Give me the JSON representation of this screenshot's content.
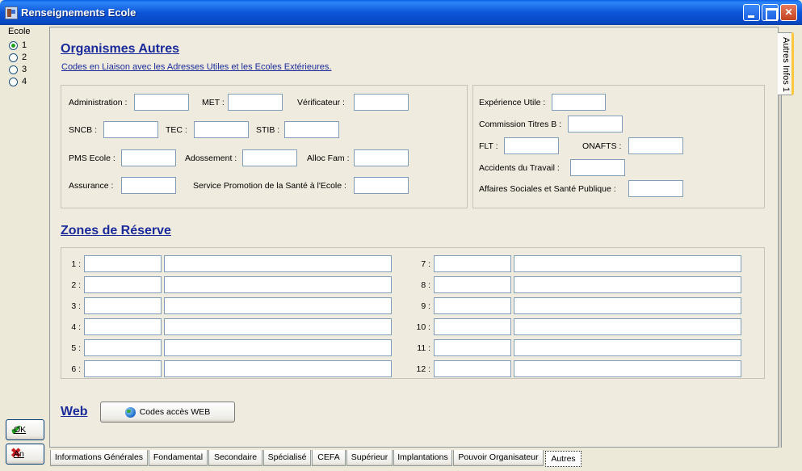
{
  "window": {
    "title": "Renseignements Ecole"
  },
  "left": {
    "ecole_label": "Ecole",
    "radios": [
      "1",
      "2",
      "3",
      "4"
    ],
    "selected": "1",
    "ok_label": "OK",
    "cancel_label": "An"
  },
  "right_tab": {
    "label": "Autres Infos 1"
  },
  "organismes": {
    "title": "Organismes Autres",
    "subtitle": "Codes en Liaison avec les Adresses Utiles et les Ecoles Extérieures.",
    "labels": {
      "administration": "Administration :",
      "met": "MET :",
      "verificateur": "Vérificateur :",
      "sncb": "SNCB :",
      "tec": "TEC :",
      "stib": "STIB :",
      "pms": "PMS Ecole :",
      "adossement": "Adossement :",
      "alloc": "Alloc Fam :",
      "assurance": "Assurance :",
      "service": "Service Promotion de la Santé à l'Ecole :",
      "experience": "Expérience Utile :",
      "commission": "Commission Titres B :",
      "flt": "FLT :",
      "onafts": "ONAFTS :",
      "accidents": "Accidents du Travail :",
      "affaires": "Affaires Sociales et Santé Publique :"
    }
  },
  "reserve": {
    "title": "Zones de Réserve",
    "rows_left": [
      "1 :",
      "2 :",
      "3 :",
      "4 :",
      "5 :",
      "6 :"
    ],
    "rows_right": [
      "7 :",
      "8 :",
      "9 :",
      "10 :",
      "11 :",
      "12 :"
    ]
  },
  "web": {
    "title": "Web",
    "button_label": "Codes accès WEB"
  },
  "tabs": [
    "Informations Générales",
    "Fondamental",
    "Secondaire",
    "Spécialisé",
    "CEFA",
    "Supérieur",
    "Implantations",
    "Pouvoir Organisateur",
    "Autres"
  ],
  "active_tab": "Autres"
}
